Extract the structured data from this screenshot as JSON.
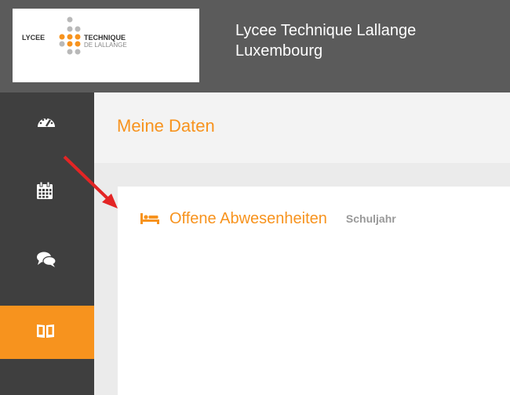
{
  "header": {
    "school_name_line1": "Lycee Technique Lallange",
    "school_name_line2": "Luxembourg"
  },
  "logo": {
    "word_left": "LYCEE",
    "word_right": "TECHNIQUE",
    "word_bottom": "DE LALLANGE"
  },
  "sidebar": {
    "items": [
      {
        "icon": "dashboard-icon"
      },
      {
        "icon": "calendar-icon"
      },
      {
        "icon": "chat-icon"
      },
      {
        "icon": "book-icon",
        "active": true
      }
    ]
  },
  "main": {
    "page_title": "Meine Daten",
    "panel": {
      "title": "Offene Abwesenheiten",
      "subtitle": "Schuljahr",
      "icon": "bed-icon"
    }
  },
  "colors": {
    "accent": "#f7931e",
    "header_bg": "#5b5b5b",
    "sidebar_bg": "#3f3f3f",
    "annotation_arrow": "#e32525"
  }
}
